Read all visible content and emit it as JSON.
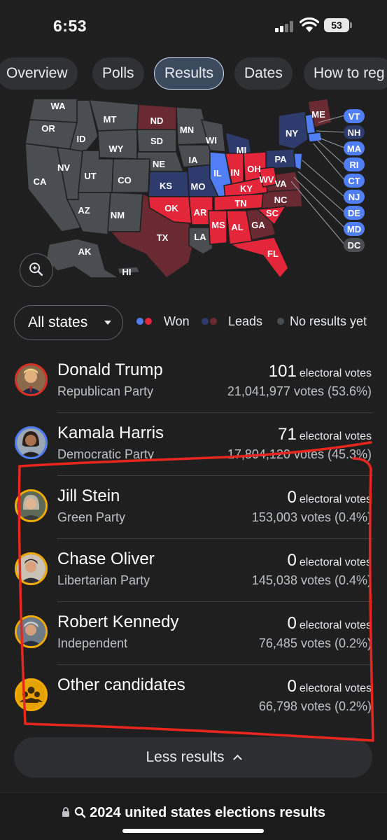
{
  "status": {
    "time": "6:53",
    "battery": "53"
  },
  "tabs": [
    {
      "label": "Overview",
      "active": false
    },
    {
      "label": "Polls",
      "active": false
    },
    {
      "label": "Results",
      "active": true
    },
    {
      "label": "Dates",
      "active": false
    },
    {
      "label": "How to reg",
      "active": false
    }
  ],
  "map": {
    "states": [
      "WA",
      "MT",
      "ND",
      "MN",
      "ME",
      "OR",
      "ID",
      "WY",
      "SD",
      "WI",
      "NY",
      "VT",
      "NH",
      "MI",
      "NV",
      "UT",
      "CO",
      "NE",
      "IA",
      "IL",
      "IN",
      "OH",
      "PA",
      "MA",
      "CA",
      "KS",
      "MO",
      "KY",
      "WV",
      "VA",
      "RI",
      "CT",
      "AZ",
      "NM",
      "OK",
      "AR",
      "TN",
      "NC",
      "NJ",
      "DE",
      "TX",
      "MS",
      "AL",
      "GA",
      "SC",
      "LA",
      "MD",
      "DC",
      "FL",
      "AK",
      "HI"
    ]
  },
  "filter": {
    "label": "All states"
  },
  "legend": {
    "won": "Won",
    "leads": "Leads",
    "no_results": "No results yet"
  },
  "colors": {
    "rep_won": "#e3263a",
    "dem_won": "#4f7ef5",
    "rep_lead": "#6a2a31",
    "dem_lead": "#2d3b6d",
    "no_results": "#4a4d52",
    "annotation": "#e8261f"
  },
  "candidates": [
    {
      "name": "Donald Trump",
      "party": "Republican Party",
      "ev": "101",
      "ev_label": "electoral votes",
      "votes": "21,041,977 votes (53.6%)",
      "ring": "#d93025",
      "icon": "trump-avatar-icon"
    },
    {
      "name": "Kamala Harris",
      "party": "Democratic Party",
      "ev": "71",
      "ev_label": "electoral votes",
      "votes": "17,804,120 votes (45.3%)",
      "ring": "#4f7ef5",
      "icon": "harris-avatar-icon"
    },
    {
      "name": "Jill Stein",
      "party": "Green Party",
      "ev": "0",
      "ev_label": "electoral votes",
      "votes": "153,003 votes (0.4%)",
      "ring": "#f2a900",
      "icon": "stein-avatar-icon"
    },
    {
      "name": "Chase Oliver",
      "party": "Libertarian Party",
      "ev": "0",
      "ev_label": "electoral votes",
      "votes": "145,038 votes (0.4%)",
      "ring": "#f2a900",
      "icon": "oliver-avatar-icon"
    },
    {
      "name": "Robert Kennedy",
      "party": "Independent",
      "ev": "0",
      "ev_label": "electoral votes",
      "votes": "76,485 votes (0.2%)",
      "ring": "#f2a900",
      "icon": "kennedy-avatar-icon"
    },
    {
      "name": "Other candidates",
      "party": "",
      "ev": "0",
      "ev_label": "electoral votes",
      "votes": "66,798 votes (0.2%)",
      "ring": "#f2a900",
      "icon": "other-candidates-icon"
    }
  ],
  "less_button": "Less results",
  "bottom_query": "2024 united states elections results"
}
